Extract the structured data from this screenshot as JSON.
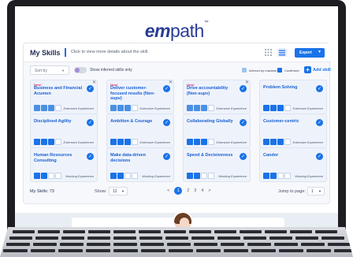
{
  "logo": {
    "em": "em",
    "path": "path",
    "tm": "™"
  },
  "panel": {
    "title": "My Skills",
    "subtitle": "Click to view more details about the skill.",
    "export_label": "Export"
  },
  "controls": {
    "sort_label": "Sort by",
    "toggle_label": "Show inferred skills only",
    "legend_machine": "Inferred by machine",
    "legend_confirmed": "Confirmed",
    "add_skill": "Add skill"
  },
  "cards": [
    {
      "new": "New!",
      "name": "Business and Financial Acumen",
      "level_label": "Extensive Experience",
      "filled": 3,
      "fill_type": "s",
      "closable": true
    },
    {
      "new": "New!",
      "name": "Deliver customer-focused results (Non-supv)",
      "level_label": "Extensive Experience",
      "filled": 3,
      "fill_type": "s",
      "closable": true
    },
    {
      "new": "New!",
      "name": "Drive accountability (Non-supv)",
      "level_label": "Extensive Experience",
      "filled": 3,
      "fill_type": "s",
      "closable": true
    },
    {
      "new": "",
      "name": "Problem Solving",
      "level_label": "Extensive Experience",
      "filled": 3,
      "fill_type": "c",
      "closable": false
    },
    {
      "new": "",
      "name": "Disciplined Agility",
      "level_label": "Extensive Experience",
      "filled": 3,
      "fill_type": "c",
      "closable": false
    },
    {
      "new": "",
      "name": "Ambition & Courage",
      "level_label": "Extensive Experience",
      "filled": 3,
      "fill_type": "c",
      "closable": false
    },
    {
      "new": "",
      "name": "Collaborating Globally",
      "level_label": "Extensive Experience",
      "filled": 3,
      "fill_type": "c",
      "closable": false
    },
    {
      "new": "",
      "name": "Customer-centric",
      "level_label": "Extensive Experience",
      "filled": 3,
      "fill_type": "c",
      "closable": false
    },
    {
      "new": "",
      "name": "Human Resources Consulting",
      "level_label": "Working Experience",
      "filled": 2,
      "fill_type": "c",
      "closable": false
    },
    {
      "new": "",
      "name": "Make data-driven decisions",
      "level_label": "Working Experience",
      "filled": 2,
      "fill_type": "c",
      "closable": false
    },
    {
      "new": "",
      "name": "Speed & Decisiveness",
      "level_label": "Working Experience",
      "filled": 2,
      "fill_type": "c",
      "closable": false
    },
    {
      "new": "",
      "name": "Candor",
      "level_label": "Working Experience",
      "filled": 2,
      "fill_type": "c",
      "closable": false
    }
  ],
  "footer": {
    "count": "My Skills: 73",
    "show_label": "Show:",
    "show_value": "12",
    "prev": "<",
    "pages": [
      "1",
      "2",
      "3",
      "4"
    ],
    "next": ">",
    "jump_label": "Jump to page:",
    "jump_value": "1"
  },
  "colors": {
    "accent": "#1a73e8",
    "brand": "#2a3c96",
    "new_badge": "#d6336c"
  }
}
